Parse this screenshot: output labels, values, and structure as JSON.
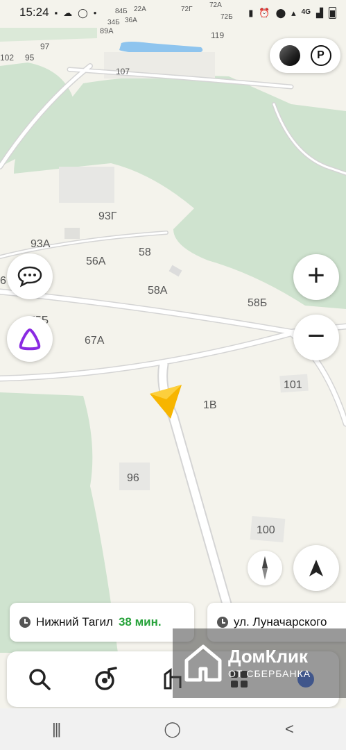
{
  "status_bar": {
    "time": "15:24",
    "left_icons": [
      "message-icon",
      "weather-icon",
      "whatsapp-icon",
      "dot-icon"
    ],
    "right_icons": [
      "sim-icon",
      "alarm-icon",
      "location-icon",
      "wifi-icon",
      "network-4g-icon",
      "signal-icon",
      "battery-icon"
    ],
    "network": "4G"
  },
  "map": {
    "colors": {
      "land": "#f4f3ec",
      "forest": "#cfe3cf",
      "road": "#ffffff",
      "road_edge": "#d4d4d4",
      "building": "#e7e7e4",
      "water": "#8ec4ee"
    },
    "house_labels": [
      {
        "id": "label-93g",
        "text": "93Г"
      },
      {
        "id": "label-93a",
        "text": "93А"
      },
      {
        "id": "label-56a",
        "text": "56А"
      },
      {
        "id": "label-58",
        "text": "58"
      },
      {
        "id": "label-58a",
        "text": "58А"
      },
      {
        "id": "label-58b",
        "text": "58Б"
      },
      {
        "id": "label-75b",
        "text": "75Б"
      },
      {
        "id": "label-67a",
        "text": "67А"
      },
      {
        "id": "label-1v",
        "text": "1В"
      },
      {
        "id": "label-101",
        "text": "101"
      },
      {
        "id": "label-96",
        "text": "96"
      },
      {
        "id": "label-100",
        "text": "100"
      },
      {
        "id": "label-107",
        "text": "107"
      },
      {
        "id": "label-97",
        "text": "97"
      },
      {
        "id": "label-102",
        "text": "102"
      },
      {
        "id": "label-95",
        "text": "95"
      },
      {
        "id": "label-119",
        "text": "119"
      },
      {
        "id": "label-89a",
        "text": "89А"
      },
      {
        "id": "label-84b",
        "text": "84Б"
      },
      {
        "id": "label-22a",
        "text": "22А"
      },
      {
        "id": "label-36a",
        "text": "36А"
      },
      {
        "id": "label-34b",
        "text": "34Б"
      },
      {
        "id": "label-72g",
        "text": "72Г"
      },
      {
        "id": "label-72a",
        "text": "72А"
      },
      {
        "id": "label-72b",
        "text": "72Б"
      },
      {
        "id": "label-6",
        "text": "6"
      }
    ]
  },
  "controls": {
    "layers_icon": "layers-icon",
    "parking_label": "P",
    "chat_icon": "chat-icon",
    "alice_icon": "alice-icon",
    "zoom_in_label": "+",
    "zoom_out_label": "−",
    "compass_icon": "compass-icon",
    "my_location_icon": "navigation-arrow-icon"
  },
  "routes": [
    {
      "destination": "Нижний Тагил",
      "eta": "38 мин."
    },
    {
      "destination": "ул. Луначарского"
    }
  ],
  "bottom_bar": {
    "icons": [
      "search-icon",
      "music-icon",
      "navigator-icon",
      "services-icon",
      "menu-icon"
    ]
  },
  "watermark": {
    "line1": "ДомКлик",
    "line2": "ОТ СБЕРБАНКА"
  },
  "nav_bar": {
    "recent_label": "|||",
    "home_label": "◯",
    "back_label": "<"
  }
}
